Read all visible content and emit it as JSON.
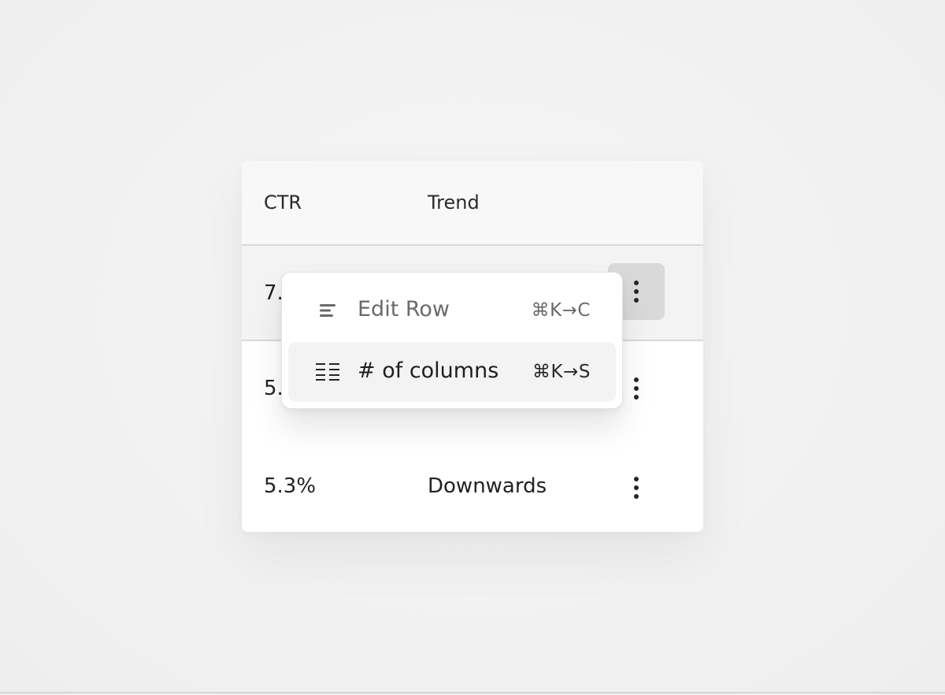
{
  "table": {
    "headers": {
      "ctr": "CTR",
      "trend": "Trend"
    },
    "rows": [
      {
        "ctr": "7.",
        "trend": "",
        "actions_active": true
      },
      {
        "ctr": "5.",
        "trend": "",
        "actions_active": false
      },
      {
        "ctr": "5.3%",
        "trend": "Downwards",
        "actions_active": false
      }
    ]
  },
  "menu": {
    "items": [
      {
        "icon": "align-left-icon",
        "label": "Edit Row",
        "shortcut": "⌘K→C",
        "highlighted": false
      },
      {
        "icon": "columns-list-icon",
        "label": "# of columns",
        "shortcut": "⌘K→S",
        "highlighted": true
      }
    ]
  },
  "colors": {
    "background": "#f2f2f2",
    "header_bg": "#f8f8f8",
    "active_row_bg": "#f3f3f3",
    "active_button_bg": "#d9d9d9",
    "text": "#222222",
    "muted_text": "#6a6a6a"
  }
}
